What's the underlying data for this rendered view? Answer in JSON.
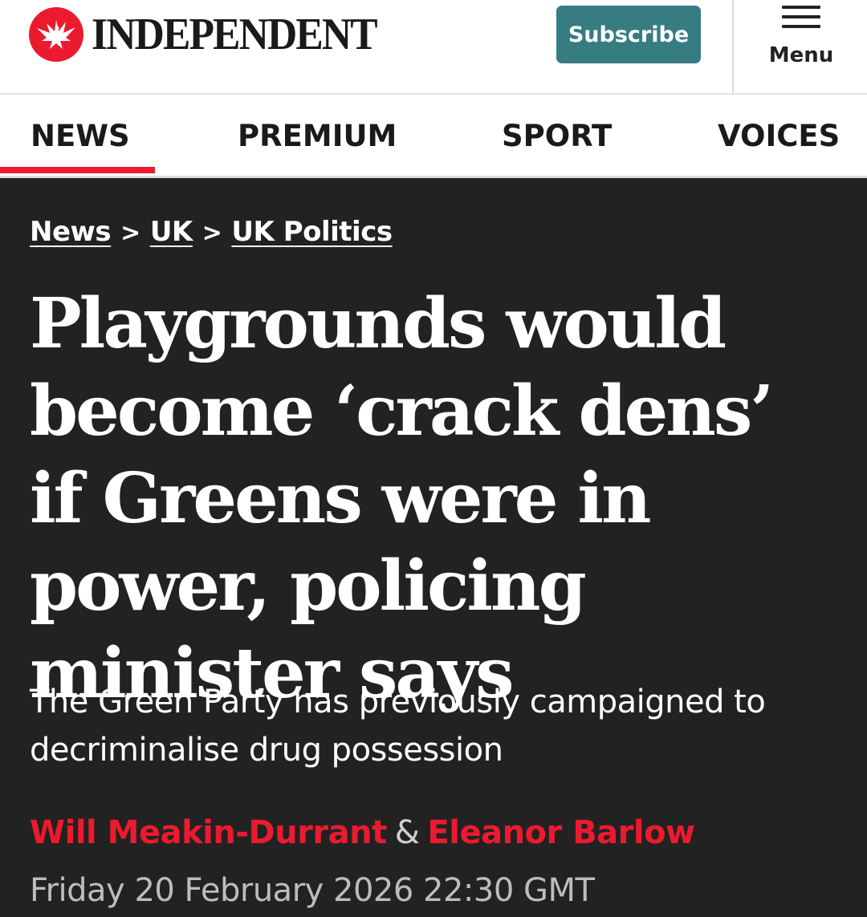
{
  "header": {
    "brand": "INDEPENDENT",
    "logo_icon": "eagle-icon",
    "subscribe_label": "Subscribe",
    "menu_label": "Menu",
    "menu_icon": "hamburger-icon",
    "colors": {
      "brand_red": "#ec1a2e",
      "subscribe_teal": "#377c81"
    }
  },
  "nav": {
    "tabs": [
      {
        "label": "NEWS",
        "active": true
      },
      {
        "label": "PREMIUM",
        "active": false
      },
      {
        "label": "SPORT",
        "active": false
      },
      {
        "label": "VOICES",
        "active": false
      }
    ]
  },
  "article": {
    "breadcrumb": [
      {
        "label": "News"
      },
      {
        "label": "UK"
      },
      {
        "label": "UK Politics"
      }
    ],
    "breadcrumb_separator": ">",
    "headline": "Playgrounds would become ‘crack dens’ if Greens were in power, policing minister says",
    "standfirst": "The Green Party has previously campaigned to decriminalise drug possession",
    "authors": [
      {
        "name": "Will Meakin-Durrant"
      },
      {
        "name": "Eleanor Barlow"
      }
    ],
    "author_joiner": "&",
    "date": "Friday 20 February 2026 22:30 GMT",
    "colors": {
      "background": "#222222",
      "author_red": "#ec1a2e"
    }
  }
}
